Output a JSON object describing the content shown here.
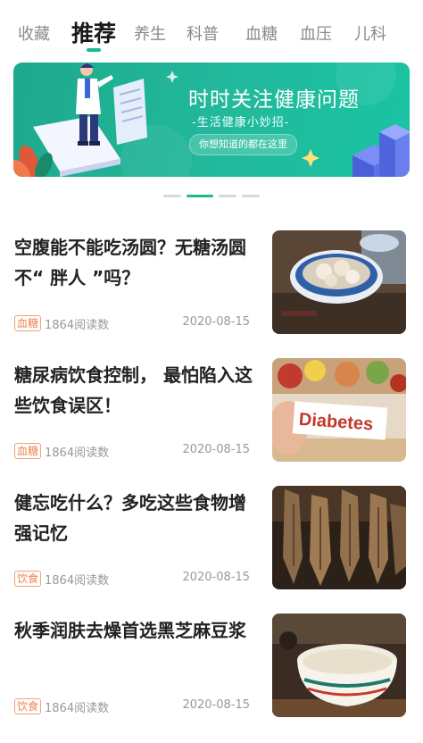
{
  "tabs": [
    {
      "label": "收藏"
    },
    {
      "label": "推荐"
    },
    {
      "label": "养生"
    },
    {
      "label": "科普"
    },
    {
      "label": "血糖"
    },
    {
      "label": "血压"
    },
    {
      "label": "儿科"
    }
  ],
  "active_tab": "推荐",
  "banner": {
    "title": "时时关注健康问题",
    "subtitle": "-生活健康小妙招-",
    "button": "你想知道的都在这里"
  },
  "carousel": {
    "pages": 4,
    "active_index": 1
  },
  "articles": [
    {
      "title": "空腹能不能吃汤圆？无糖汤圆不“ 胖人 ”吗？",
      "tag": "血糖",
      "reads": "1864阅读数",
      "date": "2020-08-15",
      "image_label": ""
    },
    {
      "title": "糖尿病饮食控制，  最怕陷入这些饮食误区！",
      "tag": "血糖",
      "reads": "1864阅读数",
      "date": "2020-08-15",
      "image_label": "Diabetes"
    },
    {
      "title": "健忘吃什么？多吃这些食物增强记忆",
      "tag": "饮食",
      "reads": "1864阅读数",
      "date": "2020-08-15",
      "image_label": ""
    },
    {
      "title": "秋季润肤去燥首选黑芝麻豆浆",
      "tag": "饮食",
      "reads": "1864阅读数",
      "date": "2020-08-15",
      "image_label": ""
    }
  ],
  "colors": {
    "accent": "#1fb98f",
    "tag": "#f0834d"
  }
}
